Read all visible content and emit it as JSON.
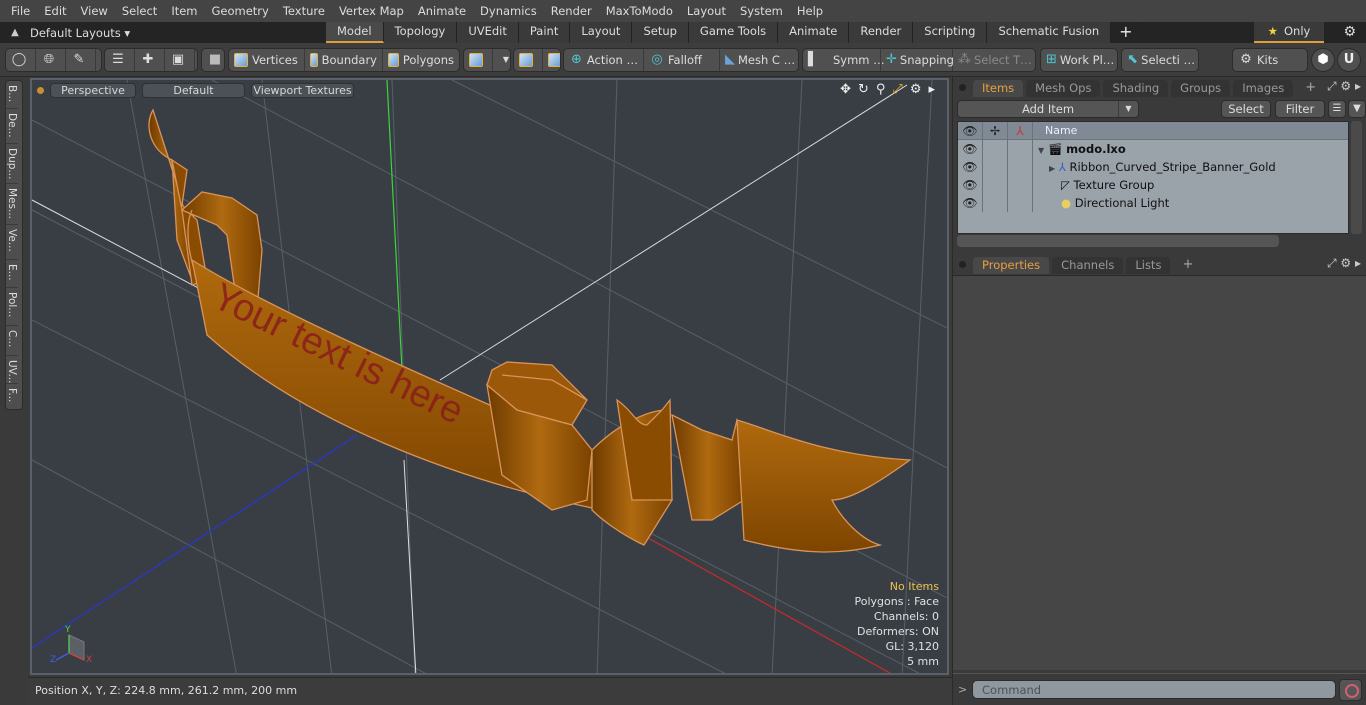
{
  "menu": [
    "File",
    "Edit",
    "View",
    "Select",
    "Item",
    "Geometry",
    "Texture",
    "Vertex Map",
    "Animate",
    "Dynamics",
    "Render",
    "MaxToModo",
    "Layout",
    "System",
    "Help"
  ],
  "layoutbar": {
    "layouts_label": "Default Layouts ▾",
    "tabs": [
      "Model",
      "Topology",
      "UVEdit",
      "Paint",
      "Layout",
      "Setup",
      "Game Tools",
      "Animate",
      "Render",
      "Scripting",
      "Schematic Fusion"
    ],
    "active_tab": "Model",
    "only_label": "Only"
  },
  "toolbar": {
    "vertices": "Vertices",
    "boundary": "Boundary",
    "polygons": "Polygons",
    "action": "Action …",
    "falloff": "Falloff",
    "mesh_c": "Mesh C …",
    "symm": "Symm …",
    "snapping": "Snapping",
    "select_t": "Select T…",
    "work_pl": "Work Pl…",
    "selecti": "Selecti …",
    "kits": "Kits"
  },
  "left_tabs": [
    "B...",
    "De...",
    "Dup...",
    "Mes...",
    "Ve...",
    "E...",
    "Pol...",
    "C...",
    "UV...",
    "F..."
  ],
  "viewport": {
    "view_mode": "Perspective",
    "shading": "Default",
    "textures": "Viewport Textures",
    "banner_text": "Your text is here",
    "info": {
      "selection": "No Items",
      "polygons": "Polygons : Face",
      "channels": "Channels: 0",
      "deformers": "Deformers: ON",
      "gl": "GL: 3,120",
      "grid": "5 mm"
    },
    "colors": {
      "banner": "#a05a08",
      "edge": "#d9935a",
      "text": "#8a1c1c"
    }
  },
  "status": {
    "position": "Position X, Y, Z:   224.8 mm, 261.2 mm, 200 mm"
  },
  "right_panel": {
    "top_tabs": [
      "Items",
      "Mesh Ops",
      "Shading",
      "Groups",
      "Images"
    ],
    "active_top_tab": "Items",
    "add_item": "Add Item",
    "select": "Select",
    "filter": "Filter",
    "tree_header": "Name",
    "tree": [
      {
        "name": "modo.lxo",
        "bold": true,
        "icon": "scene-icon"
      },
      {
        "name": "Ribbon_Curved_Stripe_Banner_Gold",
        "icon": "mesh-locator-icon"
      },
      {
        "name": "Texture Group",
        "icon": "texture-group-icon"
      },
      {
        "name": "Directional Light",
        "icon": "light-icon"
      }
    ],
    "bottom_tabs": [
      "Properties",
      "Channels",
      "Lists"
    ],
    "active_bottom_tab": "Properties",
    "command_placeholder": "Command",
    "prompt": ">"
  }
}
